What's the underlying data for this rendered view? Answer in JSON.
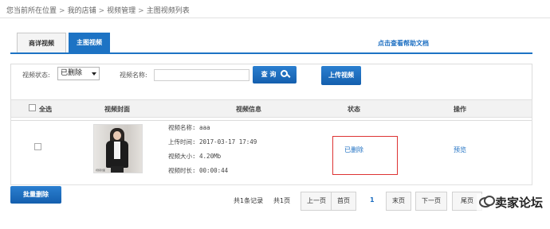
{
  "breadcrumb": {
    "prefix": "您当前所在位置",
    "items": [
      "我的店铺",
      "视频管理",
      "主图视频列表"
    ],
    "separator": ">"
  },
  "tabs": [
    {
      "label": "商详视频",
      "active": false
    },
    {
      "label": "主图视频",
      "active": true
    }
  ],
  "help_link": "点击查看帮助文档",
  "filter": {
    "status_label": "视频状态:",
    "status_value": "已删除",
    "name_label": "视频名称:",
    "name_value": "",
    "search_label": "查 询",
    "upload_label": "上传视频"
  },
  "table": {
    "headers": [
      "全选",
      "视频封面",
      "视频信息",
      "状态",
      "操作"
    ],
    "rows": [
      {
        "cover_caption": "视频封面",
        "name": "视频名称: aaa",
        "upload_time": "上传时间: 2017-03-17 17:49",
        "size": "视频大小: 4.20Mb",
        "duration": "视频时长: 00:00:44",
        "status": "已删除",
        "action": "预览"
      }
    ]
  },
  "bulk_delete_label": "批量删除",
  "pagination": {
    "total_records": "共1条记录",
    "total_pages": "共1页",
    "prev": "上一页",
    "first": "首页",
    "current": "1",
    "last": "末页",
    "next": "下一页",
    "end": "尾页"
  },
  "watermark": "卖家论坛",
  "colors": {
    "accent": "#1d73c4",
    "link": "#1d6fc2",
    "highlight_box": "#dd3333"
  }
}
